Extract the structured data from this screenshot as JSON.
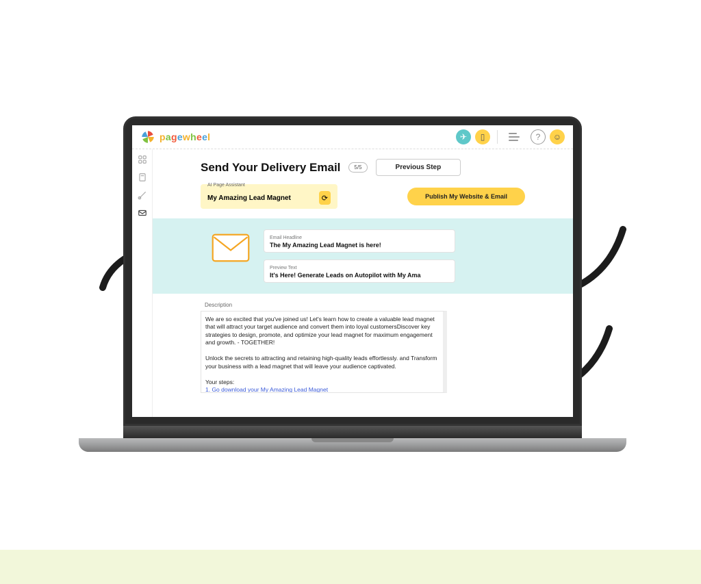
{
  "brand": "pagewheel",
  "header": {
    "icons": [
      "rocket-icon",
      "doc-icon",
      "list-icon",
      "help-icon",
      "smiley-icon"
    ]
  },
  "sidebar": {
    "icons": [
      "grid-icon",
      "page-icon",
      "paintbrush-icon",
      "mail-icon"
    ]
  },
  "page": {
    "title": "Send Your Delivery Email",
    "step": "5/5",
    "prev_button": "Previous Step",
    "assistant_label": "AI Page Assistant",
    "assistant_value": "My Amazing Lead Magnet",
    "publish_button": "Publish My Website & Email"
  },
  "email": {
    "headline_label": "Email Headline",
    "headline_value": "The My Amazing Lead Magnet is here!",
    "preview_label": "Preview Text",
    "preview_value": "It's Here! Generate Leads on Autopilot with My Ama"
  },
  "description": {
    "label": "Description",
    "para1": "We are so excited that you've joined us!  Let's learn how to create a valuable lead magnet that will attract your target audience and convert them into loyal customersDiscover key strategies to design, promote, and optimize your lead magnet for maximum engagement and growth.  - TOGETHER!",
    "para2": "Unlock the secrets to attracting and retaining high-quality leads effortlessly. and Transform your business with a lead magnet that will leave your audience captivated.",
    "steps_label": "Your steps:",
    "step1": "1. Go download your My Amazing Lead Magnet"
  }
}
